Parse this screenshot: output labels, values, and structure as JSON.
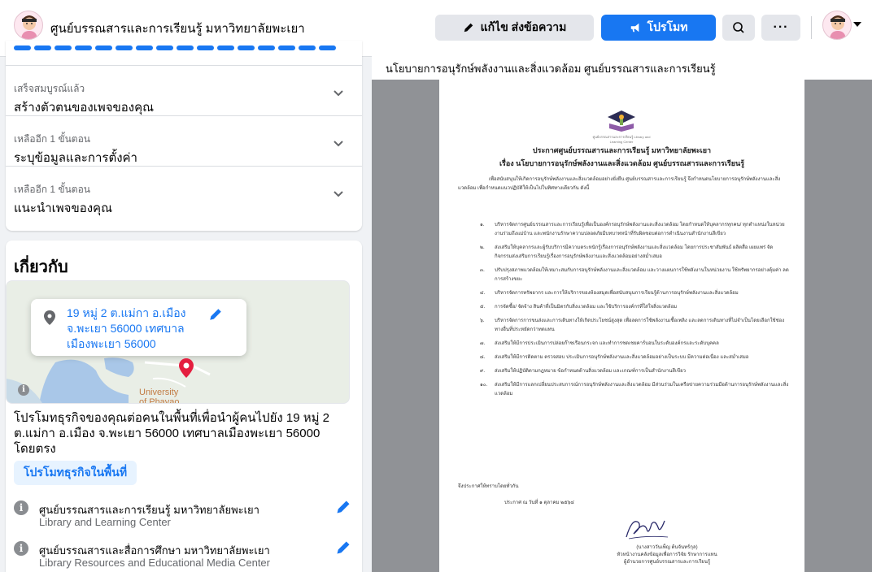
{
  "header": {
    "page_name": "ศูนย์บรรณสารและการเรียนรู้ มหาวิทยาลัยพะเยา",
    "avatar_icon": "mascot-avatar-icon",
    "edit_button_label": "แก้ไข ส่งข้อความ",
    "edit_button_icon": "pencil-icon",
    "promote_button_label": "โปรโมท",
    "promote_button_icon": "megaphone-icon",
    "search_icon": "search-icon",
    "more_label": "···",
    "accent_color": "#1877f2"
  },
  "setup_steps": [
    {
      "status": "เสร็จสมบูรณ์แล้ว",
      "title": "สร้างตัวตนของเพจของคุณ"
    },
    {
      "status": "เหลืออีก 1 ขั้นตอน",
      "title": "ระบุข้อมูลและการตั้งค่า"
    },
    {
      "status": "เหลืออีก 1 ขั้นตอน",
      "title": "แนะนำเพจของคุณ"
    }
  ],
  "about": {
    "title": "เกี่ยวกับ",
    "address": "19 หมู่ 2 ต.แม่กา อ.เมือง จ.พะเยา 56000 เทศบาลเมืองพะเยา 56000",
    "map_label_line1": "University",
    "map_label_line2": "of Phavao",
    "map_info": "i",
    "promo_text": "โปรโมทธุรกิจของคุณต่อคนในพื้นที่เพื่อนำผู้คนไปยัง 19 หมู่ 2 ต.แม่กา อ.เมือง จ.พะเยา 56000 เทศบาลเมืองพะเยา 56000 โดยตรง",
    "local_button_label": "โปรโมทธุรกิจในพื้นที่",
    "info_rows": [
      {
        "line1": "ศูนย์บรรณสารและการเรียนรู้ มหาวิทยาลัยพะเยา",
        "line2": "Library and Learning Center"
      },
      {
        "line1": "ศูนย์บรรณสารและสื่อการศึกษา มหาวิทยาลัยพะเยา",
        "line2": "Library Resources and Educational Media Center"
      }
    ]
  },
  "post": {
    "caption": "นโยบายการอนุรักษ์พลังงานและสิ่งแวดล้อม ศูนย์บรรณสารและการเรียนรู้",
    "document": {
      "logo_text": "ศูนย์บรรณสารและการเรียนรู้ Library and Learning Center",
      "title_line1": "ประกาศศูนย์บรรณสารและการเรียนรู้ มหาวิทยาลัยพะเยา",
      "title_line2": "เรื่อง นโยบายการอนุรักษ์พลังงานและสิ่งแวดล้อม ศูนย์บรรณสารและการเรียนรู้",
      "intro": "เพื่อสนับสนุนให้เกิดการอนุรักษ์พลังงานและสิ่งแวดล้อมอย่างยั่งยืน ศูนย์บรรณสารและการเรียนรู้ จึงกำหนดนโยบายการอนุรักษ์พลังงานและสิ่งแวดล้อม เพื่อกำหนดแนวปฏิบัติให้เป็นไปในทิศทางเดียวกัน ดังนี้",
      "items": [
        {
          "num": "๑.",
          "text": "บริหารจัดการศูนย์บรรณสารและการเรียนรู้เพื่อเป็นองค์กรอนุรักษ์พลังงานและสิ่งแวดล้อม โดยกำหนดให้บุคลากรทุกคน/ ทุกตำแหน่งในหน่วยงานร่วมถึงแม่บ้าน และพนักงานรักษาความปลอดภัยมีบทบาทหน้าที่รับผิดชอบต่อการดำเนินงานสำนักงานสีเขียว"
        },
        {
          "num": "๒.",
          "text": "ส่งเสริมให้บุคลากรและผู้รับบริการมีความตระหนักรู้เรื่องการอนุรักษ์พลังงานและสิ่งแวดล้อม โดยการประชาสัมพันธ์ ผลิตสื่อ เผยแพร่ จัดกิจกรรมส่งเสริมการเรียนรู้เรื่องการอนุรักษ์พลังงานและสิ่งแวดล้อมอย่างสม่ำเสมอ"
        },
        {
          "num": "๓.",
          "text": "ปรับปรุงสภาพแวดล้อมให้เหมาะสมกับการอนุรักษ์พลังงานและสิ่งแวดล้อม และวางแผนการใช้พลังงานในหน่วยงาน ใช้ทรัพยากรอย่างคุ้มค่า ลดการสร้างขยะ"
        },
        {
          "num": "๔.",
          "text": "บริหารจัดการทรัพยากร และการให้บริการของห้องสมุดเพื่อสนับสนุนการเรียนรู้ด้านการอนุรักษ์พลังงานและสิ่งแวดล้อม"
        },
        {
          "num": "๕.",
          "text": "การจัดซื้อ/ จัดจ้าง สินค้าที่เป็นมิตรกับสิ่งแวดล้อม และใช้บริการองค์กรที่ใส่ใจสิ่งแวดล้อม"
        },
        {
          "num": "๖.",
          "text": "บริหารจัดการการขนส่งและการเดินทางให้เกิดประโยชน์สูงสุด เพื่อลดการใช้พลังงานเชื้อเพลิง และลดการเดินทางที่ไม่จำเป็นโดยเลือกใช้ช่องทางอื่นที่ประหยัดกว่าทดแทน"
        },
        {
          "num": "๗.",
          "text": "ส่งเสริมให้มีการประเมินการปล่อยก๊าซเรือนกระจก และทำการชดเชยคาร์บอนในระดับองค์กรและระดับบุคคล"
        },
        {
          "num": "๘.",
          "text": "ส่งเสริมให้มีการติดตาม ตรวจสอบ ประเมินการอนุรักษ์พลังงานและสิ่งแวดล้อมอย่างเป็นระบบ มีความต่อเนื่อง และสม่ำเสมอ"
        },
        {
          "num": "๙.",
          "text": "ส่งเสริมให้ปฏิบัติตามกฎหมาย ข้อกำหนดด้านสิ่งแวดล้อม และเกณฑ์การเป็นสำนักงานสีเขียว"
        },
        {
          "num": "๑๐.",
          "text": "ส่งเสริมให้มีการแลกเปลี่ยนประสบการณ์การอนุรักษ์พลังงานและสิ่งแวดล้อม มีส่วนร่วมในเครือข่ายความร่วมมือด้านการอนุรักษ์พลังงานและสิ่งแวดล้อม"
        }
      ],
      "closing": "จึงประกาศให้ทราบโดยทั่วกัน",
      "date": "ประกาศ ณ วันที่ ๑ ตุลาคม ๒๕๖๔",
      "signer_name": "(นางสาววันเพ็ญ ต้นจันทร์กุล)",
      "signer_title1": "หัวหน้างานคลังข้อมูลเพื่อการวิจัย รักษาการแทน",
      "signer_title2": "ผู้อำนวยการศูนย์บรรณสารและการเรียนรู้"
    }
  }
}
